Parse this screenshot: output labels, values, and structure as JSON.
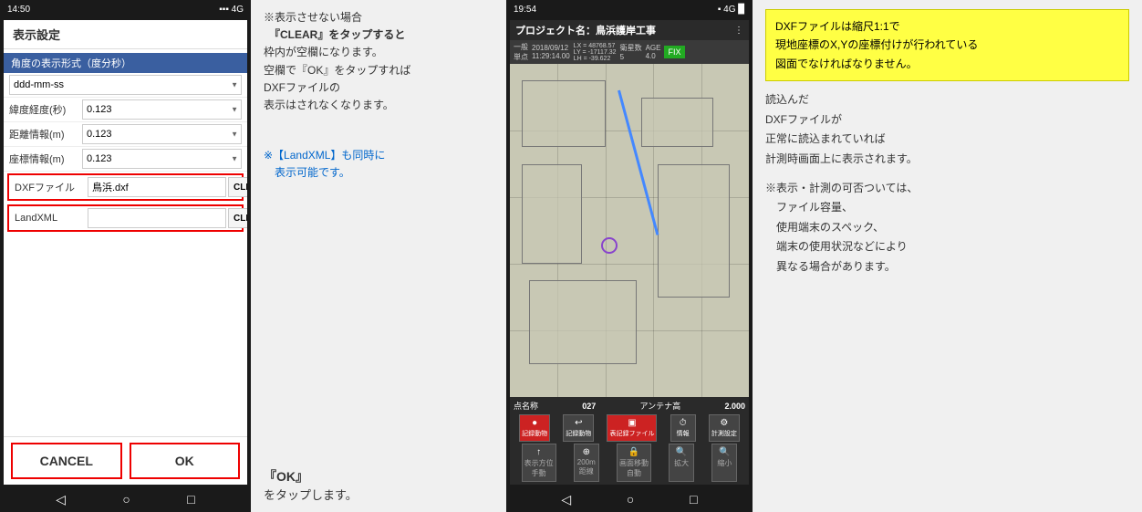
{
  "leftPhone": {
    "statusBar": {
      "time": "14:50",
      "icons": "🔋"
    },
    "dialogTitle": "表示設定",
    "sectionLabel": "角度の表示形式（度分秒）",
    "selectOptions": [
      "ddd-mm-ss"
    ],
    "rows": [
      {
        "label": "緯度経度(秒)",
        "value": "0.123"
      },
      {
        "label": "距離情報(m)",
        "value": "0.123"
      },
      {
        "label": "座標情報(m)",
        "value": "0.123"
      }
    ],
    "dxfRow": {
      "label": "DXFファイル",
      "value": "鳥浜.dxf",
      "clearLabel": "CLEAR"
    },
    "landxmlRow": {
      "label": "LandXML",
      "value": "",
      "clearLabel": "CLEAR"
    },
    "buttons": {
      "cancel": "CANCEL",
      "ok": "OK"
    }
  },
  "middleText": {
    "instruction1": "※表示させない場合",
    "instruction2": "『CLEAR』をタップすると",
    "instruction3": "枠内が空欄になります。",
    "instruction4": "空欄で『OK』をタップすれば",
    "instruction5": "DXFファイルの",
    "instruction6": "表示はされなくなります。",
    "blueNote": "※【LandXML】も同時に\n　表示可能です。",
    "okInstruction1": "『OK』",
    "okInstruction2": "をタップします。"
  },
  "rightPhone": {
    "statusBar": {
      "time": "19:54"
    },
    "projectTitle": "プロジェクト名：鳥浜護岸工事",
    "infoBar": {
      "type": "一般 単点",
      "date": "2018/09/12 11:29:14.00",
      "coords": "LX = 48768.572 LY = -17117.321 LH = -39.622",
      "count": "衛星数 5",
      "age": "AGE 4.0"
    },
    "bottomBar": {
      "pointName": "点名称",
      "pointValue": "027",
      "antennaLabel": "アンテナ高",
      "antennaValue": "2.000"
    },
    "toolbar": [
      {
        "icon": "●",
        "label": "記録動物",
        "red": true
      },
      {
        "icon": "↩",
        "label": "記録動物",
        "red": false
      },
      {
        "icon": "📷",
        "label": "表記録ファイル",
        "red": true
      },
      {
        "icon": "⏱",
        "label": "情報",
        "red": false
      },
      {
        "icon": "⚙",
        "label": "計測設定",
        "red": false
      }
    ],
    "toolbar2": [
      {
        "icon": "↑",
        "label": "表示方位 手動"
      },
      {
        "icon": "⊕",
        "label": "200m 距線"
      },
      {
        "icon": "🔒",
        "label": "画面移動 自動"
      },
      {
        "icon": "🔍",
        "label": "拡大"
      },
      {
        "icon": "🔍",
        "label": "縮小"
      }
    ]
  },
  "rightText": {
    "yellowBox": "DXFファイルは縮尺1:1で\n現地座標のX,Yの座標付けが行われている\n図面でなければなりません。",
    "description": "読込んだ\nDXFファイルが\n正常に読込まれていれば\n計測時画面上に表示されます。",
    "note": "※表示・計測の可否ついては、\n　ファイル容量、\n　使用端末のスペック、\n　端末の使用状況などにより\n　異なる場合があります。"
  }
}
